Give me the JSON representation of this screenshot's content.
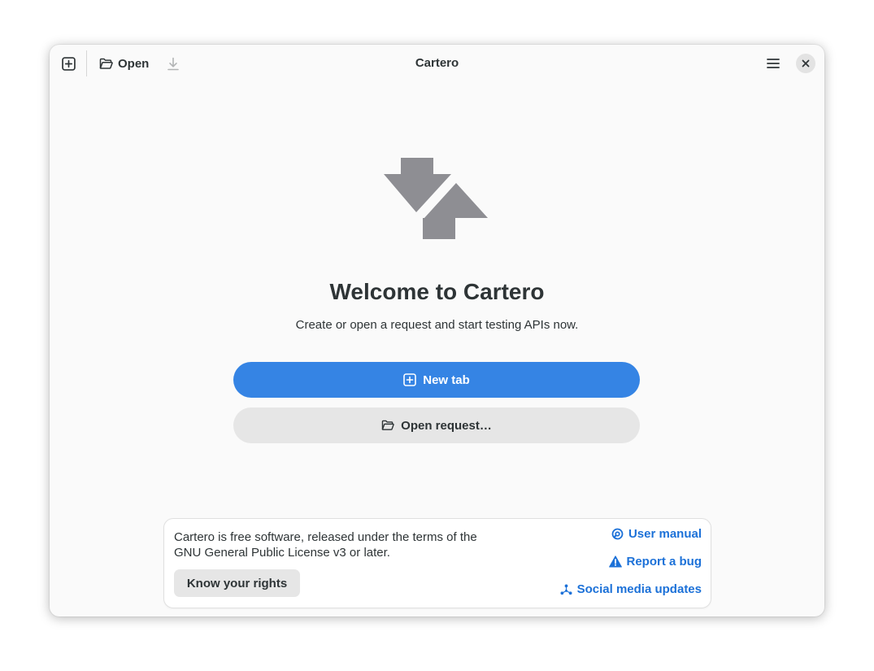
{
  "window": {
    "title": "Cartero"
  },
  "headerbar": {
    "open_label": "Open",
    "icons": {
      "new_tab": "tab-new-icon",
      "open": "folder-open-icon",
      "save": "download-icon",
      "menu": "hamburger-menu-icon",
      "close": "close-icon"
    }
  },
  "welcome": {
    "heading": "Welcome to Cartero",
    "subtitle": "Create or open a request and start testing APIs now.",
    "new_tab_label": "New tab",
    "open_request_label": "Open request…",
    "hero_icon": "transfer-arrows-icon"
  },
  "footer": {
    "license_text": "Cartero is free software, released under the terms of the GNU General Public License v3 or later.",
    "rights_button": "Know your rights",
    "links": [
      {
        "label": "User manual",
        "icon": "help-lifebuoy-icon"
      },
      {
        "label": "Report a bug",
        "icon": "warning-icon"
      },
      {
        "label": "Social media updates",
        "icon": "network-icon"
      }
    ]
  },
  "colors": {
    "accent": "#3584e4",
    "link": "#1c71d8",
    "window_bg": "#fafafa",
    "text": "#2e3436",
    "hero_icon": "#8e8e93"
  }
}
